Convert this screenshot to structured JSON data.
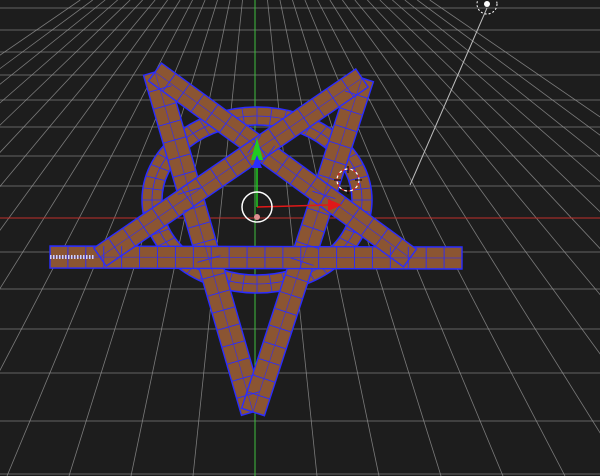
{
  "viewport": {
    "background": "#1d1d1d",
    "grid_color": "#9a9a9a",
    "x_axis_color": "#c0302a",
    "y_axis_color": "#3fbf3f"
  },
  "object": {
    "name": "pentagram",
    "fill_color": "#8b5532",
    "wire_color": "#2a2cff",
    "selected": true
  },
  "gizmo": {
    "x_arrow_color": "#e01818",
    "y_arrow_color": "#22cc22",
    "z_arrow_color": "#2a2cff",
    "center_ring_color": "#ffffff"
  },
  "icons": {
    "light": "lamp-icon",
    "cursor": "3d-cursor-icon"
  }
}
